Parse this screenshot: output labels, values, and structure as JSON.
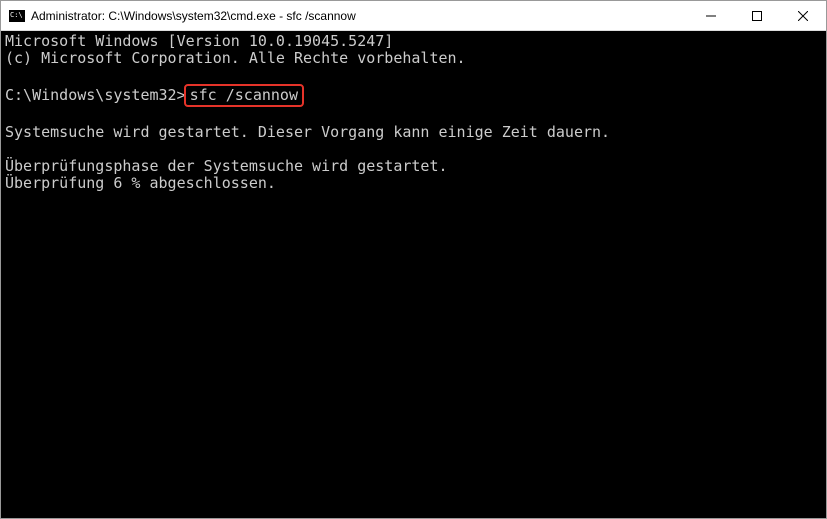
{
  "window": {
    "title": "Administrator: C:\\Windows\\system32\\cmd.exe - sfc  /scannow"
  },
  "terminal": {
    "line1": "Microsoft Windows [Version 10.0.19045.5247]",
    "line2": "(c) Microsoft Corporation. Alle Rechte vorbehalten.",
    "prompt": "C:\\Windows\\system32>",
    "command": "sfc /scannow",
    "line3": "Systemsuche wird gestartet. Dieser Vorgang kann einige Zeit dauern.",
    "line4": "Überprüfungsphase der Systemsuche wird gestartet.",
    "line5": "Überprüfung 6 % abgeschlossen."
  }
}
